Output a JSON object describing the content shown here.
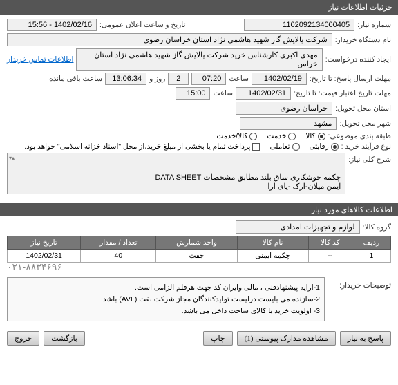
{
  "headerTitle": "جزئیات اطلاعات نیاز",
  "fields": {
    "needNumber": {
      "label": "شماره نیاز:",
      "value": "1102092134000405"
    },
    "publicAnnounce": {
      "label": "تاریخ و ساعت اعلان عمومی:",
      "value": "1402/02/16 - 15:56"
    },
    "buyerOrg": {
      "label": "نام دستگاه خریدار:",
      "value": "شرکت پالایش گاز شهید هاشمی نژاد   استان خراسان رضوی"
    },
    "requester": {
      "label": "ایجاد کننده درخواست:",
      "value": "مهدی اکبری کارشناس خرید شرکت پالایش گاز شهید هاشمی نژاد   استان خراس"
    },
    "contactLink": "اطلاعات تماس خریدار",
    "deadline": {
      "label": "مهلت ارسال پاسخ: تا تاریخ:",
      "date": "1402/02/19",
      "timeLabel": "ساعت",
      "time": "07:20",
      "daysVal": "2",
      "daysLabel": "روز و",
      "remainTime": "13:06:34",
      "remainLabel": "ساعت باقی مانده"
    },
    "validity": {
      "label": "مهلت تاریخ اعتبار قیمت: تا تاریخ:",
      "date": "1402/02/31",
      "timeLabel": "ساعت",
      "time": "15:00"
    },
    "province": {
      "label": "استان محل تحویل:",
      "value": "خراسان رضوی"
    },
    "city": {
      "label": "شهر محل تحویل:",
      "value": "مشهد"
    },
    "category": {
      "label": "طبقه بندی موضوعی:",
      "options": [
        {
          "label": "کالا",
          "checked": true
        },
        {
          "label": "خدمت",
          "checked": false
        },
        {
          "label": "کالا/خدمت",
          "checked": false
        }
      ]
    },
    "process": {
      "label": "نوع فرآیند خرید :",
      "options": [
        {
          "label": "رقابتی",
          "checked": true
        },
        {
          "label": "تعاملی",
          "checked": false
        }
      ],
      "checkbox": {
        "label": "پرداخت تمام یا بخشی از مبلغ خرید،از محل \"اسناد خزانه اسلامی\" خواهد بود.",
        "checked": false
      }
    },
    "description": {
      "label": "شرح کلی نیاز:",
      "value": "چکمه جوشکاری ساق بلند مطابق مشخصات DATA SHEET\nایمن میلان-ارک -پای آرا"
    }
  },
  "goodsSection": {
    "title": "اطلاعات کالاهای مورد نیاز",
    "groupLabel": "گروه کالا:",
    "groupValue": "لوازم و تجهیزات امدادی"
  },
  "table": {
    "headers": [
      "ردیف",
      "کد کالا",
      "نام کالا",
      "واحد شمارش",
      "تعداد / مقدار",
      "تاریخ نیاز"
    ],
    "rows": [
      [
        "1",
        "--",
        "چکمه ایمنی",
        "جفت",
        "40",
        "1402/02/31"
      ]
    ]
  },
  "phone": "۰۲۱-۸۸۳۴۶۹۶",
  "buyerNotes": {
    "label": "توضیحات خریدار:",
    "text": "1-ارایه پیشنهادفنی ، مالی وایران کد جهت هرقلم الزامی است.\n2-سازنده می بایست درلیست تولیدکنندگان مجاز شرکت نفت (AVL)  باشد.\n3- اولویت خرید  با کالای ساخت  داخل می باشد."
  },
  "footer": {
    "respond": "پاسخ به نیاز",
    "attachments": "مشاهده مدارک پیوستی (1)",
    "print": "چاپ",
    "back": "بازگشت",
    "exit": "خروج"
  }
}
